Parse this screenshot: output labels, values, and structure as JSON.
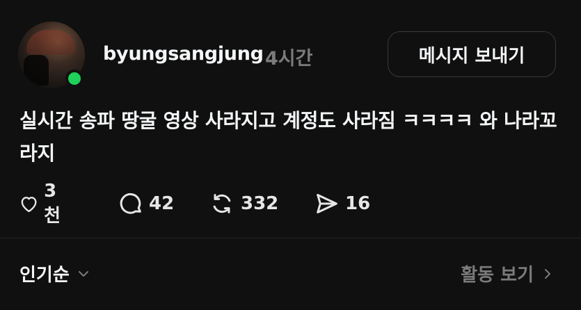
{
  "post": {
    "username": "byungsangjung",
    "time": "4시간",
    "message_button": "메시지 보내기",
    "text": "실시간 송파 땅굴 영상 사라지고 계정도 사라짐 ㅋㅋㅋㅋ 와 나라꼬라지",
    "online": true
  },
  "actions": {
    "likes": "3천",
    "comments": "42",
    "reposts": "332",
    "shares": "16"
  },
  "footer": {
    "sort_label": "인기순",
    "activity_label": "활동 보기"
  },
  "colors": {
    "background": "#101010",
    "text": "#f3f5f7",
    "muted": "#7b7b7b",
    "online": "#1fd05a"
  }
}
